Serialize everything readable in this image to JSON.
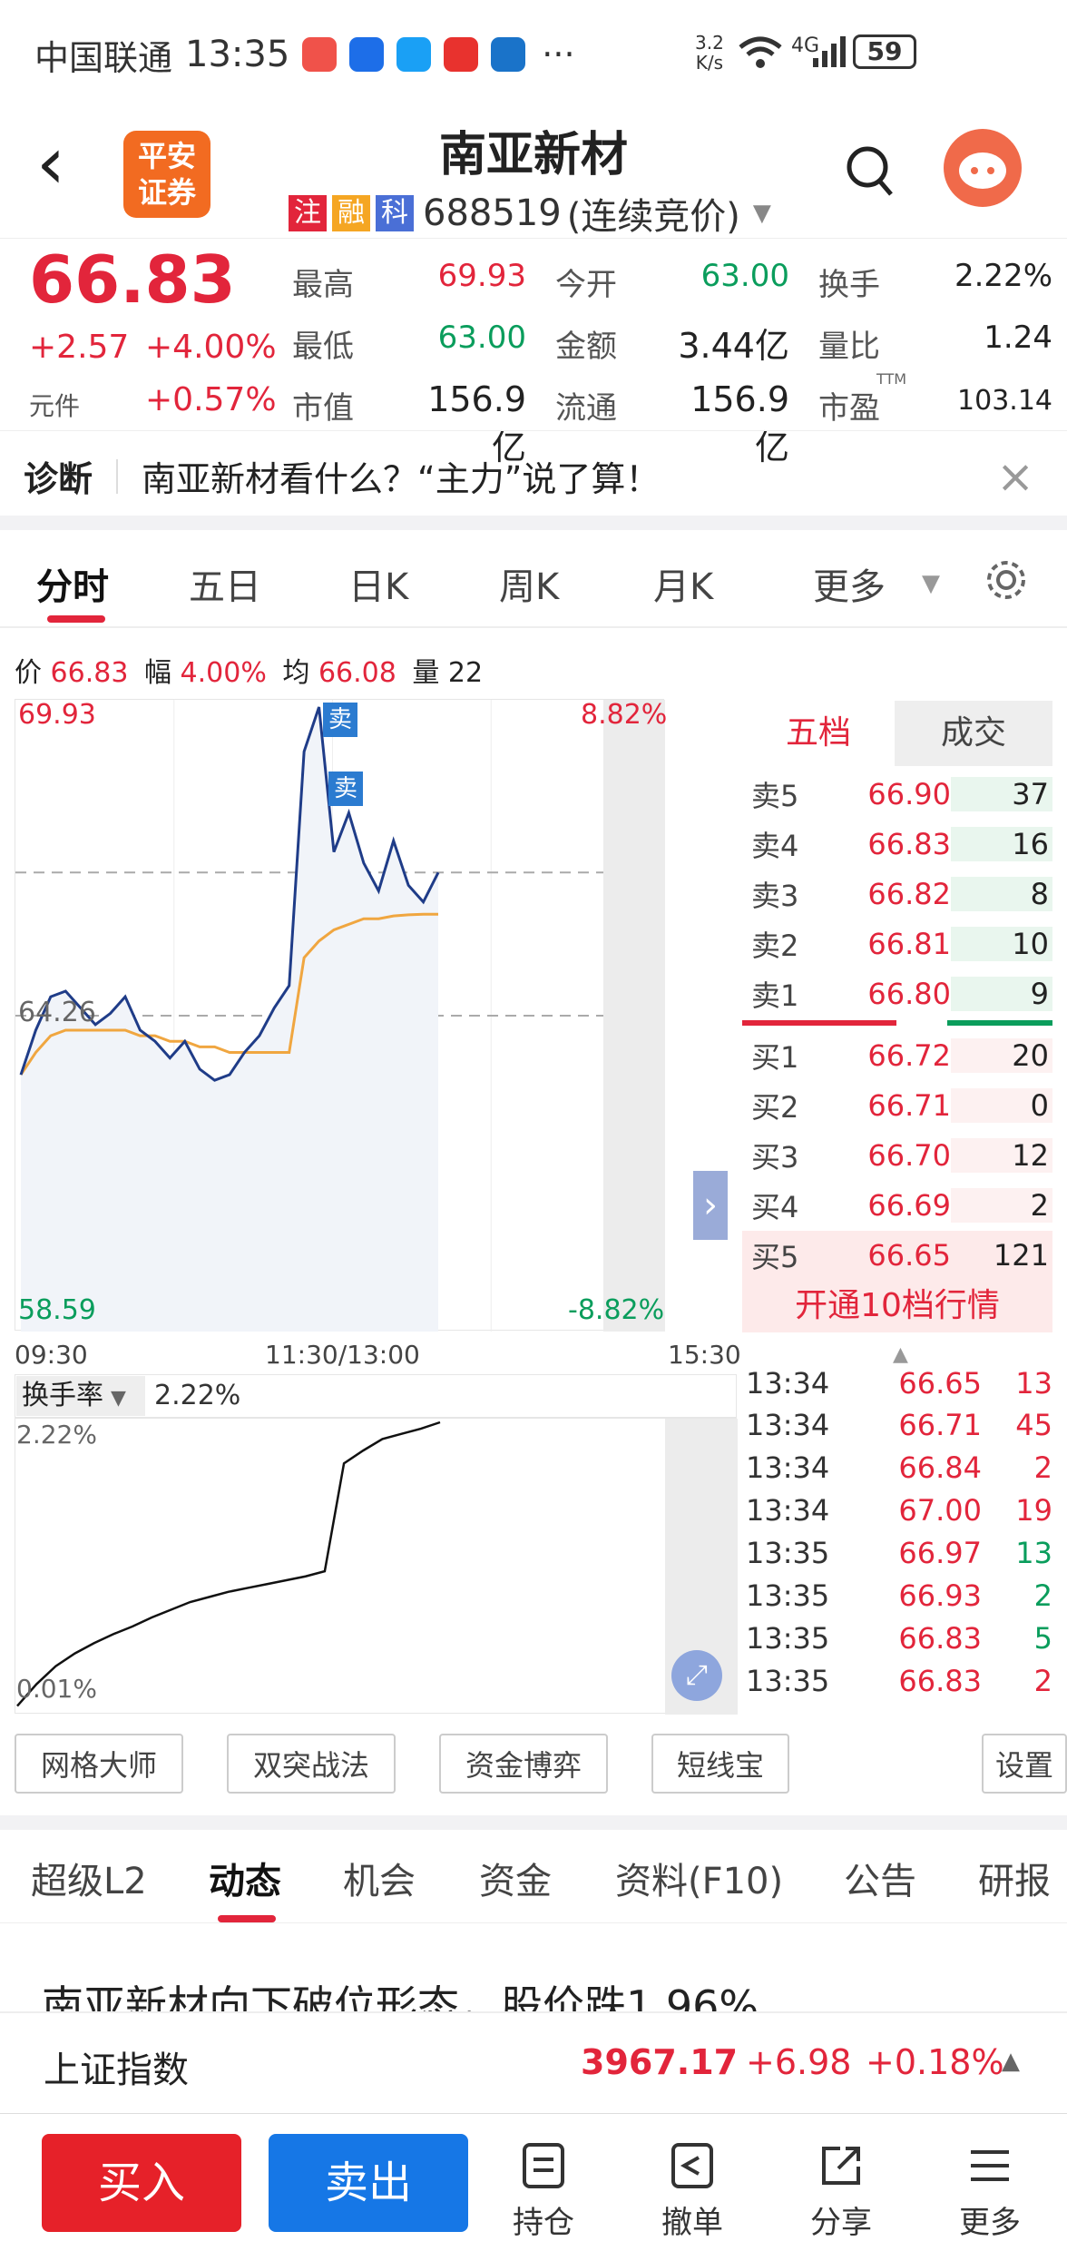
{
  "status_bar": {
    "carrier": "中国联通",
    "time": "13:35",
    "net_speed_top": "3.2",
    "net_speed_bottom": "K/s",
    "signal": "4G",
    "battery": "59",
    "more": "···"
  },
  "header": {
    "back": "‹",
    "broker_logo_line1": "平安",
    "broker_logo_line2": "证券",
    "title": "南亚新材",
    "tags": [
      "注",
      "融",
      "科"
    ],
    "code": "688519",
    "mode": "(连续竞价)"
  },
  "quote": {
    "price": "66.83",
    "change": "+2.57",
    "change_pct": "+4.00%",
    "unit_label": "元件",
    "unit_pct": "+0.57%",
    "fields": [
      {
        "label": "最高",
        "value": "69.93"
      },
      {
        "label": "今开",
        "value": "63.00"
      },
      {
        "label": "换手",
        "value": "2.22%"
      },
      {
        "label": "最低",
        "value": "63.00"
      },
      {
        "label": "金额",
        "value": "3.44亿"
      },
      {
        "label": "量比",
        "value": "1.24"
      },
      {
        "label": "市值",
        "value": "156.9亿"
      },
      {
        "label": "流通",
        "value": "156.9亿"
      },
      {
        "label": "市盈",
        "value": "103.14",
        "sup": "TTM"
      }
    ]
  },
  "diagnosis": {
    "label": "诊断",
    "text": "南亚新材看什么？“主力”说了算！",
    "close": "×"
  },
  "chart_tabs": [
    "分时",
    "五日",
    "日K",
    "周K",
    "月K",
    "更多"
  ],
  "info_line": {
    "price_label": "价",
    "price": "66.83",
    "amp_label": "幅",
    "amp": "4.00%",
    "avg_label": "均",
    "avg": "66.08",
    "vol_label": "量",
    "vol": "22"
  },
  "chart_data": {
    "type": "line",
    "ylim": [
      58.59,
      69.93
    ],
    "y_labels": {
      "top": "69.93",
      "bottom": "58.59",
      "mid": "64.26",
      "top_pct": "8.82%",
      "bottom_pct": "-8.82%"
    },
    "x_labels": [
      "09:30",
      "11:30/13:00",
      "15:30"
    ],
    "markers": [
      "卖",
      "卖"
    ],
    "series": [
      {
        "name": "价",
        "values": [
          63.2,
          64.0,
          64.6,
          64.7,
          64.4,
          64.1,
          64.3,
          64.6,
          64.0,
          63.8,
          63.5,
          63.8,
          63.3,
          63.1,
          63.2,
          63.6,
          63.9,
          64.4,
          64.8,
          69.0,
          69.8,
          67.2,
          67.9,
          67.0,
          66.5,
          67.4,
          66.6,
          66.3,
          66.83
        ]
      },
      {
        "name": "均",
        "values": [
          63.2,
          63.6,
          63.9,
          64.0,
          64.0,
          64.0,
          64.0,
          64.0,
          63.9,
          63.9,
          63.8,
          63.8,
          63.7,
          63.7,
          63.6,
          63.6,
          63.6,
          63.6,
          63.6,
          65.3,
          65.6,
          65.8,
          65.9,
          66.0,
          66.0,
          66.05,
          66.07,
          66.08,
          66.08
        ]
      }
    ]
  },
  "orderbook": {
    "tabs": [
      "五档",
      "成交"
    ],
    "asks": [
      {
        "label": "卖5",
        "price": "66.90",
        "qty": "37"
      },
      {
        "label": "卖4",
        "price": "66.83",
        "qty": "16"
      },
      {
        "label": "卖3",
        "price": "66.82",
        "qty": "8"
      },
      {
        "label": "卖2",
        "price": "66.81",
        "qty": "10"
      },
      {
        "label": "卖1",
        "price": "66.80",
        "qty": "9"
      }
    ],
    "bids": [
      {
        "label": "买1",
        "price": "66.72",
        "qty": "20"
      },
      {
        "label": "买2",
        "price": "66.71",
        "qty": "0"
      },
      {
        "label": "买3",
        "price": "66.70",
        "qty": "12"
      },
      {
        "label": "买4",
        "price": "66.69",
        "qty": "2"
      },
      {
        "label": "买5",
        "price": "66.65",
        "qty": "121"
      }
    ],
    "upgrade": "开通10档行情"
  },
  "ticks": [
    {
      "time": "13:34",
      "price": "66.65",
      "qty": "13",
      "dir": "red"
    },
    {
      "time": "13:34",
      "price": "66.71",
      "qty": "45",
      "dir": "red"
    },
    {
      "time": "13:34",
      "price": "66.84",
      "qty": "2",
      "dir": "red"
    },
    {
      "time": "13:34",
      "price": "67.00",
      "qty": "19",
      "dir": "red"
    },
    {
      "time": "13:35",
      "price": "66.97",
      "qty": "13",
      "dir": "green"
    },
    {
      "time": "13:35",
      "price": "66.93",
      "qty": "2",
      "dir": "green"
    },
    {
      "time": "13:35",
      "price": "66.83",
      "qty": "5",
      "dir": "green"
    },
    {
      "time": "13:35",
      "price": "66.83",
      "qty": "2",
      "dir": "red"
    }
  ],
  "turnover": {
    "label": "换手率",
    "value": "2.22%",
    "top": "2.22%",
    "bottom": "0.01%",
    "values": [
      0.01,
      0.18,
      0.32,
      0.42,
      0.5,
      0.57,
      0.63,
      0.7,
      0.76,
      0.82,
      0.86,
      0.9,
      0.93,
      0.96,
      0.99,
      1.02,
      1.06,
      1.9,
      2.0,
      2.09,
      2.13,
      2.17,
      2.22
    ]
  },
  "tools": [
    "网格大师",
    "双突战法",
    "资金博弈",
    "短线宝",
    "设置"
  ],
  "bottom_tabs": [
    "超级L2",
    "动态",
    "机会",
    "资金",
    "资料(F10)",
    "公告",
    "研报"
  ],
  "news_peek": "南亚新材向下破位形态，股价跌1.96%",
  "index_bar": {
    "name": "上证指数",
    "value": "3967.17",
    "change": "+6.98",
    "pct": "+0.18%"
  },
  "actions": {
    "buy": "买入",
    "sell": "卖出",
    "nav": [
      "持仓",
      "撤单",
      "分享",
      "更多"
    ]
  }
}
